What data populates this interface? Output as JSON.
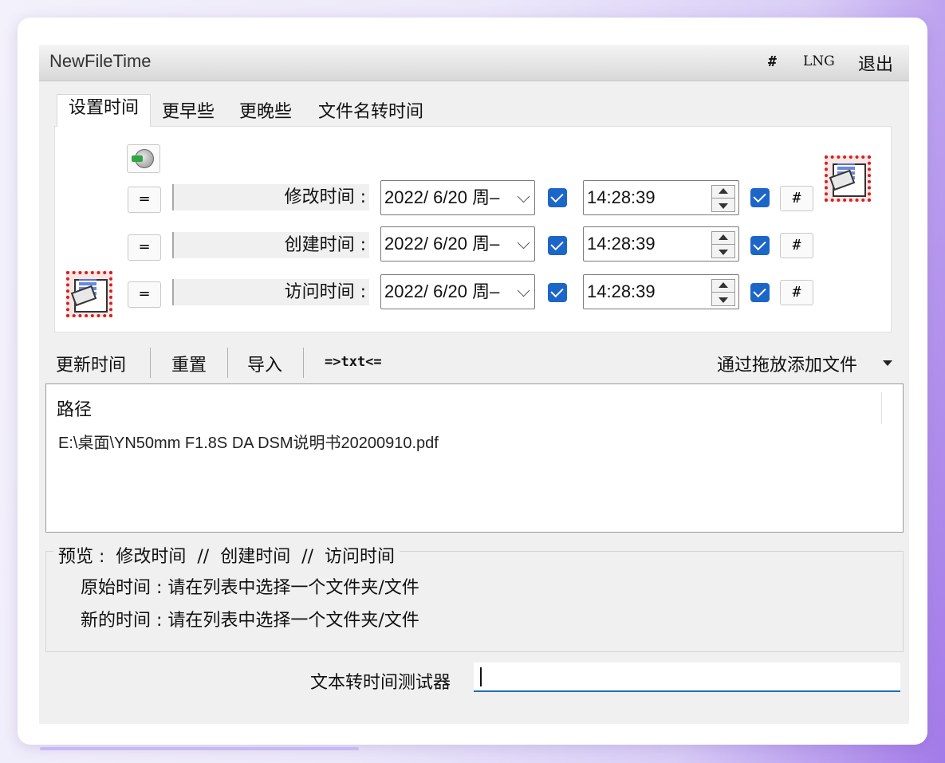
{
  "app": {
    "title": "NewFileTime",
    "hash_label": "#",
    "lng_label": "LNG",
    "exit_label": "退出"
  },
  "tabs": [
    {
      "label": "设置时间",
      "active": true
    },
    {
      "label": "更早些",
      "active": false
    },
    {
      "label": "更晚些",
      "active": false
    },
    {
      "label": "文件名转时间",
      "active": false
    }
  ],
  "time_rows": [
    {
      "eq": "=",
      "label": "修改时间 :",
      "date": "2022/  6/20 周–",
      "date_checked": true,
      "time": "14:28:39",
      "time_checked": true,
      "hash": "#"
    },
    {
      "eq": "=",
      "label": "创建时间 :",
      "date": "2022/  6/20 周–",
      "date_checked": true,
      "time": "14:28:39",
      "time_checked": true,
      "hash": "#"
    },
    {
      "eq": "=",
      "label": "访问时间 :",
      "date": "2022/  6/20 周–",
      "date_checked": true,
      "time": "14:28:39",
      "time_checked": true,
      "hash": "#"
    }
  ],
  "toolbar": {
    "update": "更新时间",
    "reset": "重置",
    "import": "导入",
    "txt": "=>txt<=",
    "drop": "通过拖放添加文件"
  },
  "list": {
    "header": "路径",
    "rows": [
      "E:\\桌面\\YN50mm F1.8S DA DSM说明书20200910.pdf"
    ]
  },
  "preview": {
    "legend": "预览 :  修改时间  //  创建时间  //  访问时间",
    "original": "原始时间 : 请在列表中选择一个文件夹/文件",
    "new": "新的时间 : 请在列表中选择一个文件夹/文件"
  },
  "tester": {
    "label": "文本转时间测试器",
    "value": ""
  },
  "colors": {
    "checkbox": "#1c66c7",
    "input_underline": "#1f6fb5",
    "window_bg": "#f0f0f0"
  }
}
